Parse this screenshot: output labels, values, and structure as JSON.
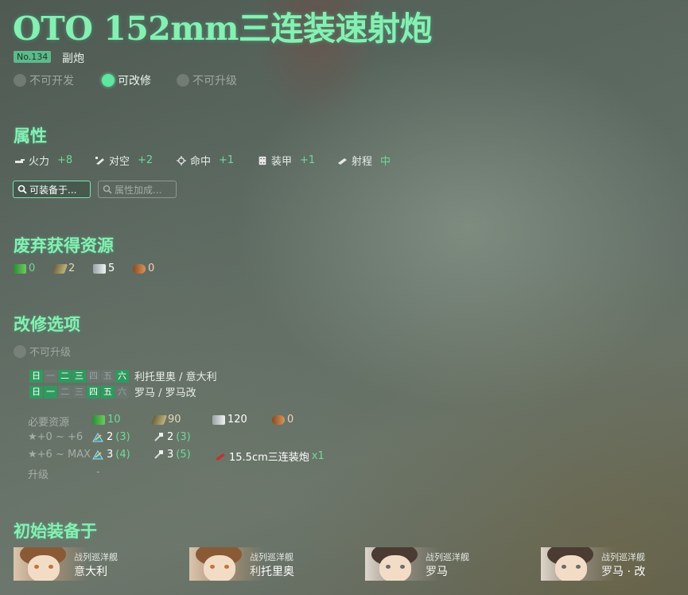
{
  "equipment": {
    "name": "OTO 152mm三连装速射炮",
    "id_badge": "No.134",
    "type": "副炮",
    "flags": [
      {
        "label": "不可开发",
        "active": false
      },
      {
        "label": "可改修",
        "active": true
      },
      {
        "label": "不可升级",
        "active": false
      }
    ]
  },
  "stats_section": {
    "title": "属性",
    "items": [
      {
        "icon": "firepower-icon",
        "label": "火力",
        "value": "+8"
      },
      {
        "icon": "anti-air-icon",
        "label": "对空",
        "value": "+2"
      },
      {
        "icon": "accuracy-icon",
        "label": "命中",
        "value": "+1"
      },
      {
        "icon": "armor-icon",
        "label": "装甲",
        "value": "+1"
      },
      {
        "icon": "range-icon",
        "label": "射程",
        "value": "中"
      }
    ],
    "buttons": [
      {
        "label": "可装备于...",
        "icon": "search-icon"
      },
      {
        "label": "属性加成...",
        "icon": "search-icon"
      }
    ]
  },
  "scrap_section": {
    "title": "废弃获得资源",
    "resources": [
      {
        "icon": "fuel-icon",
        "value": "0"
      },
      {
        "icon": "ammo-icon",
        "value": "2"
      },
      {
        "icon": "steel-icon",
        "value": "5"
      },
      {
        "icon": "bauxite-icon",
        "value": "0"
      }
    ]
  },
  "improve_section": {
    "title": "改修选项",
    "upgrade_flag": "不可升级",
    "schedules": [
      {
        "days": [
          {
            "d": "日",
            "on": true
          },
          {
            "d": "一",
            "on": false
          },
          {
            "d": "二",
            "on": true
          },
          {
            "d": "三",
            "on": true
          },
          {
            "d": "四",
            "on": false
          },
          {
            "d": "五",
            "on": false
          },
          {
            "d": "六",
            "on": true
          }
        ],
        "ships": "利托里奥 / 意大利"
      },
      {
        "days": [
          {
            "d": "日",
            "on": true
          },
          {
            "d": "一",
            "on": true
          },
          {
            "d": "二",
            "on": false
          },
          {
            "d": "三",
            "on": false
          },
          {
            "d": "四",
            "on": true
          },
          {
            "d": "五",
            "on": true
          },
          {
            "d": "六",
            "on": false
          }
        ],
        "ships": "罗马 / 罗马改"
      }
    ],
    "requirements": {
      "resources_label": "必要资源",
      "resources": [
        {
          "icon": "fuel-icon",
          "value": "10"
        },
        {
          "icon": "ammo-icon",
          "value": "90"
        },
        {
          "icon": "steel-icon",
          "value": "120"
        },
        {
          "icon": "bauxite-icon",
          "value": "0"
        }
      ],
      "stage1_label": "★+0 ~ +6",
      "stage1": {
        "devmat": "2",
        "devmat_sure": "(3)",
        "screw": "2",
        "screw_sure": "(3)"
      },
      "stage2_label": "★+6 ~ MAX",
      "stage2": {
        "devmat": "3",
        "devmat_sure": "(4)",
        "screw": "3",
        "screw_sure": "(5)",
        "equip": "15.5cm三连装炮",
        "equip_count": "x1"
      },
      "upgrade_label": "升级",
      "upgrade_value": "-"
    }
  },
  "initial_section": {
    "title": "初始装备于",
    "ships": [
      {
        "type": "战列巡洋舰",
        "name": "意大利"
      },
      {
        "type": "战列巡洋舰",
        "name": "利托里奥"
      },
      {
        "type": "战列巡洋舰",
        "name": "罗马"
      },
      {
        "type": "战列巡洋舰",
        "name": "罗马 · 改"
      }
    ]
  },
  "colors": {
    "accent": "#86f0b3",
    "value_green": "#6fd99a",
    "active_day": "#2e9a5e"
  }
}
